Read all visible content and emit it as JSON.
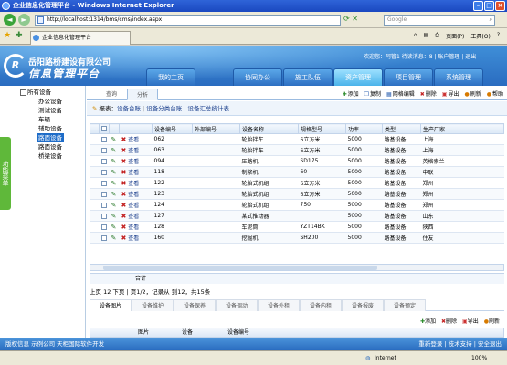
{
  "window": {
    "title": "企业信息化管理平台 - Windows Internet Explorer"
  },
  "browser": {
    "address": "http://localhost:1314/bms/cms/index.aspx",
    "search_placeholder": "Google",
    "tab_title": "企业信息化管理平台",
    "tools": {
      "page": "页面(P)",
      "tools": "工具(O)",
      "help": "?"
    }
  },
  "header": {
    "logo_line1": "岳阳路桥建设有限公司",
    "logo_line2": "信息管理平台",
    "welcome": "欢迎您：阿管1 待读消息：8 | 账户管理 | 退出"
  },
  "nav": {
    "tabs": [
      {
        "label": "我的主页"
      },
      {
        "label": "协同办公"
      },
      {
        "label": "施工队伍"
      },
      {
        "label": "资产管理"
      },
      {
        "label": "项目管理"
      },
      {
        "label": "系统管理"
      }
    ]
  },
  "sidebar": {
    "tab_label": "功能菜单",
    "root": "所有设备",
    "items": [
      {
        "label": "办公设备"
      },
      {
        "label": "测试设备"
      },
      {
        "label": "车辆"
      },
      {
        "label": "辅助设备"
      },
      {
        "label": "路面设备"
      },
      {
        "label": "路面设备"
      },
      {
        "label": "桥梁设备"
      }
    ]
  },
  "content": {
    "subtabs": [
      {
        "label": "查询"
      },
      {
        "label": "分析"
      }
    ],
    "toolbar": [
      {
        "icon": "add-icon",
        "label": "添加"
      },
      {
        "icon": "copy-icon",
        "label": "复制"
      },
      {
        "icon": "edit-icon",
        "label": "网格编辑"
      },
      {
        "icon": "delete-icon",
        "label": "删除"
      },
      {
        "icon": "export-icon",
        "label": "导出"
      },
      {
        "icon": "refresh-icon",
        "label": "刷新"
      },
      {
        "icon": "help-icon",
        "label": "帮助"
      }
    ],
    "quicklinks": {
      "prefix": "报表：",
      "links": [
        {
          "label": "设备台账"
        },
        {
          "label": "设备分类台账"
        },
        {
          "label": "设备汇总统计表"
        }
      ]
    },
    "columns": [
      "",
      "",
      "",
      "",
      "设备编号",
      "外部编号",
      "设备名称",
      "规格型号",
      "功率",
      "类型",
      "生产厂家"
    ],
    "view_label": "查看",
    "rows": [
      {
        "code": "062",
        "ext": "",
        "name": "轮胎拌车",
        "spec": "6立方米",
        "power": "5000",
        "type": "路基设备",
        "maker": "上海"
      },
      {
        "code": "063",
        "ext": "",
        "name": "轮胎拌车",
        "spec": "6立方米",
        "power": "5000",
        "type": "路基设备",
        "maker": "上海"
      },
      {
        "code": "094",
        "ext": "",
        "name": "压路机",
        "spec": "SD175",
        "power": "5000",
        "type": "路基设备",
        "maker": "英格索兰"
      },
      {
        "code": "118",
        "ext": "",
        "name": "制浆机",
        "spec": "60",
        "power": "5000",
        "type": "路基设备",
        "maker": "中联"
      },
      {
        "code": "122",
        "ext": "",
        "name": "轮胎式机组",
        "spec": "6立方米",
        "power": "5000",
        "type": "路基设备",
        "maker": "郑州"
      },
      {
        "code": "123",
        "ext": "",
        "name": "轮胎式机组",
        "spec": "6立方米",
        "power": "5000",
        "type": "路基设备",
        "maker": "郑州"
      },
      {
        "code": "124",
        "ext": "",
        "name": "轮胎式机组",
        "spec": "750",
        "power": "5000",
        "type": "路基设备",
        "maker": "郑州"
      },
      {
        "code": "127",
        "ext": "",
        "name": "某式推动器",
        "spec": "",
        "power": "5000",
        "type": "路基设备",
        "maker": "山东"
      },
      {
        "code": "128",
        "ext": "",
        "name": "车泥筒",
        "spec": "YZT14BK",
        "power": "5000",
        "type": "路基设备",
        "maker": "陕西"
      },
      {
        "code": "160",
        "ext": "",
        "name": "挖掘机",
        "spec": "SH200",
        "power": "5000",
        "type": "路基设备",
        "maker": "住友"
      }
    ],
    "total_label": "合计",
    "pager": "上页 12 下页 | 页1/2，记录从 到12，共15条",
    "bottom_tabs": [
      {
        "label": "设备图片"
      },
      {
        "label": "设备维护"
      },
      {
        "label": "设备保养"
      },
      {
        "label": "设备调动"
      },
      {
        "label": "设备外租"
      },
      {
        "label": "设备内租"
      },
      {
        "label": "设备报废"
      },
      {
        "label": "设备预定"
      }
    ],
    "bottom_toolbar": [
      {
        "icon": "add-icon",
        "label": "添加"
      },
      {
        "icon": "delete-icon",
        "label": "删除"
      },
      {
        "icon": "export-icon",
        "label": "导出"
      },
      {
        "icon": "refresh-icon",
        "label": "刷新"
      }
    ],
    "bottom_columns": [
      "",
      "图片",
      "设备",
      "设备编号"
    ]
  },
  "footer": {
    "left": "版权信息 示例公司 天柜国际软件开发",
    "right": "重新登录 | 技术支持 | 安全退出"
  },
  "status": {
    "zone": "Internet",
    "zoom": "100%"
  }
}
